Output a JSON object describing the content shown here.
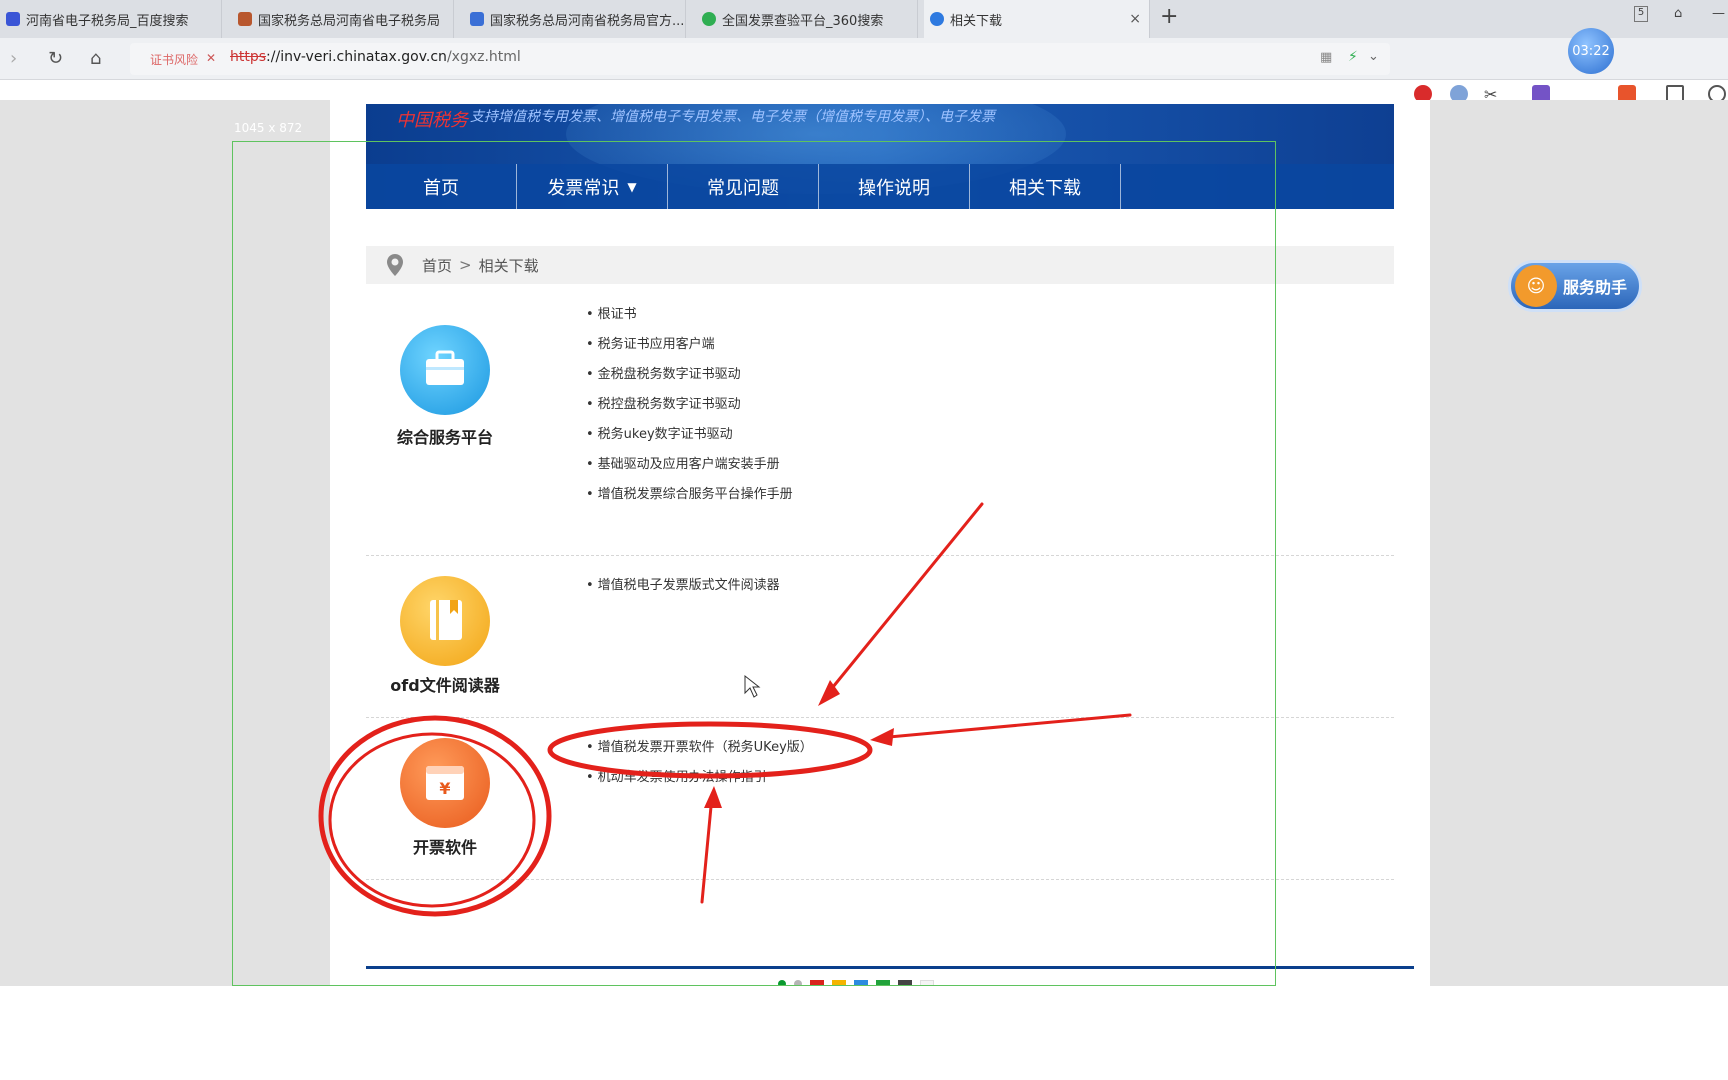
{
  "browser": {
    "tabs": [
      {
        "title": "河南省电子税务局_百度搜索",
        "favicon_color": "#3a55d6"
      },
      {
        "title": "国家税务总局河南省电子税务局",
        "favicon_color": "#b8572e"
      },
      {
        "title": "国家税务总局河南省税务局官方...",
        "favicon_color": "#3a6fd6"
      },
      {
        "title": "全国发票查验平台_360搜索",
        "favicon_color": "#2fae52"
      },
      {
        "title": "相关下载",
        "favicon_color": "#2e7ae0"
      }
    ],
    "active_tab_index": 4,
    "new_tab_icon": "plus-icon",
    "cert_warning": "证书风险",
    "url": {
      "protocol": "https",
      "rest_host": "://inv-veri.chinatax.gov.cn",
      "path": "/xgxz.html"
    },
    "clock": "03:22"
  },
  "inspect": {
    "size_label": "1045 x 872",
    "color": "#5fc35f"
  },
  "banner": {
    "logo": "中国税务",
    "slogan": "支持增值税专用发票、增值税电子专用发票、电子发票（增值税专用发票）、电子发票"
  },
  "nav": {
    "items": [
      "首页",
      "发票常识",
      "常见问题",
      "操作说明",
      "相关下载"
    ],
    "dropdown_icon": "chevron-down-icon"
  },
  "breadcrumb": {
    "home": "首页",
    "sep": ">",
    "current": "相关下载"
  },
  "sections": [
    {
      "title": "综合服务平台",
      "icon": "briefcase-icon",
      "icon_color": "#2aa7e8",
      "links": [
        "根证书",
        "税务证书应用客户端",
        "金税盘税务数字证书驱动",
        "税控盘税务数字证书驱动",
        "税务ukey数字证书驱动",
        "基础驱动及应用客户端安装手册",
        "增值税发票综合服务平台操作手册"
      ]
    },
    {
      "title": "ofd文件阅读器",
      "icon": "book-icon",
      "icon_color": "#f6b21f",
      "links": [
        "增值税电子发票版式文件阅读器"
      ]
    },
    {
      "title": "开票软件",
      "icon": "invoice-yuan-icon",
      "icon_color": "#ee6522",
      "links": [
        "增值税发票开票软件（税务UKey版）",
        "机动车发票使用办法操作指引"
      ]
    }
  ],
  "service_helper": {
    "label": "服务助手",
    "icon": "assistant-face-icon"
  },
  "footer_colors": [
    "#0a9a2f",
    "#b5b5b5",
    "#d9231c",
    "#f4b400",
    "#2b8be0",
    "#22a33b",
    "#444444",
    "#f4f4f4"
  ],
  "annotation_color": "#e3211b"
}
